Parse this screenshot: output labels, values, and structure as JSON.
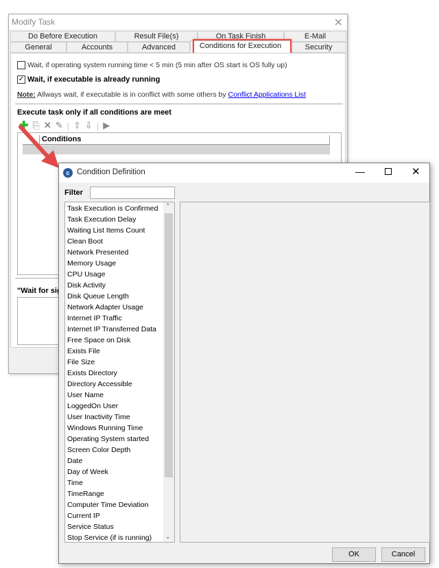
{
  "modify_task": {
    "title": "Modify Task",
    "tabs_row1": [
      "Do Before Execution",
      "Result File(s)",
      "On Task Finish",
      "E-Mail"
    ],
    "tabs_row2": [
      "General",
      "Accounts",
      "Advanced",
      "Conditions for Execution",
      "Security"
    ],
    "active_tab": "Conditions for Execution",
    "wait_os_label": "Wait, if operating system running time < 5 min (5 min after OS start is OS fully up)",
    "wait_os_checked": false,
    "wait_exec_label": "Wait, if executable is already running",
    "wait_exec_checked": true,
    "note_label": "Note:",
    "note_text": " Allways wait, if executable is in conflict with some others by ",
    "note_link": "Conflict Applications List",
    "conditions_heading": "Execute task only if all conditions are meet",
    "grid_header": "Conditions",
    "wait_signal_label": "\"Wait for sig"
  },
  "condition_definition": {
    "title": "Condition Definition",
    "filter_label": "Filter",
    "filter_value": "",
    "items": [
      "Task Execution is Confirmed",
      "Task Execution Delay",
      "Waiting List Items Count",
      "Clean Boot",
      "Network Presented",
      "Memory Usage",
      "CPU Usage",
      "Disk Activity",
      "Disk Queue Length",
      "Network Adapter Usage",
      "Internet IP Traffic",
      "Internet IP Transferred Data",
      "Free Space on Disk",
      "Exists File",
      "File Size",
      "Exists Directory",
      "Directory Accessible",
      "User Name",
      "LoggedOn User",
      "User Inactivity Time",
      "Windows Running Time",
      "Operating System started",
      "Screen Color Depth",
      "Date",
      "Day of Week",
      "Time",
      "TimeRange",
      "Computer Time Deviation",
      "Current IP",
      "Service Status",
      "Stop Service (if is running)"
    ],
    "ok_label": "OK",
    "cancel_label": "Cancel"
  },
  "colors": {
    "highlight": "#e24a4a",
    "link": "#0000ee",
    "add_icon": "#2db82d"
  }
}
